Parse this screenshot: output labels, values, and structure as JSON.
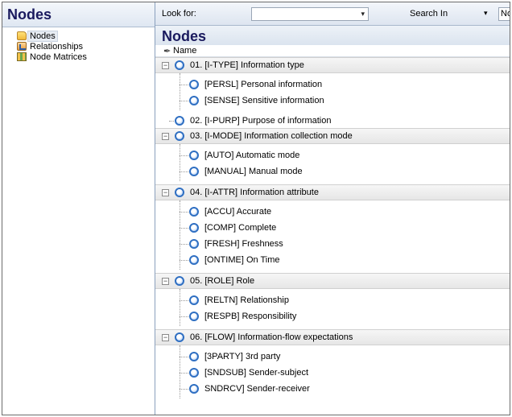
{
  "left_pane": {
    "title": "Nodes",
    "items": [
      {
        "label": "Nodes",
        "icon": "folder-icon",
        "selected": true
      },
      {
        "label": "Relationships",
        "icon": "relationships-icon",
        "selected": false
      },
      {
        "label": "Node Matrices",
        "icon": "node-matrices-icon",
        "selected": false
      }
    ]
  },
  "toolbar": {
    "look_for_label": "Look for:",
    "look_for_value": "",
    "search_in_label": "Search In",
    "search_in_value": "No"
  },
  "content": {
    "title": "Nodes",
    "column_header": "Name"
  },
  "tree": [
    {
      "label": "01. [I-TYPE] Information type",
      "expanded": true,
      "children": [
        "[PERSL] Personal information",
        "[SENSE] Sensitive information"
      ]
    },
    {
      "label": "02. [I-PURP] Purpose of information",
      "expanded": false,
      "children": []
    },
    {
      "label": "03. [I-MODE] Information collection mode",
      "expanded": true,
      "children": [
        "[AUTO] Automatic mode",
        "[MANUAL] Manual mode"
      ]
    },
    {
      "label": "04. [I-ATTR] Information attribute",
      "expanded": true,
      "children": [
        "[ACCU] Accurate",
        "[COMP] Complete",
        "[FRESH] Freshness",
        "[ONTIME] On Time"
      ]
    },
    {
      "label": "05. [ROLE] Role",
      "expanded": true,
      "children": [
        "[RELTN] Relationship",
        "[RESPB] Responsibility"
      ]
    },
    {
      "label": "06. [FLOW] Information-flow expectations",
      "expanded": true,
      "children": [
        "[3PARTY] 3rd party",
        "[SNDSUB] Sender-subject",
        "SNDRCV] Sender-receiver"
      ]
    }
  ]
}
